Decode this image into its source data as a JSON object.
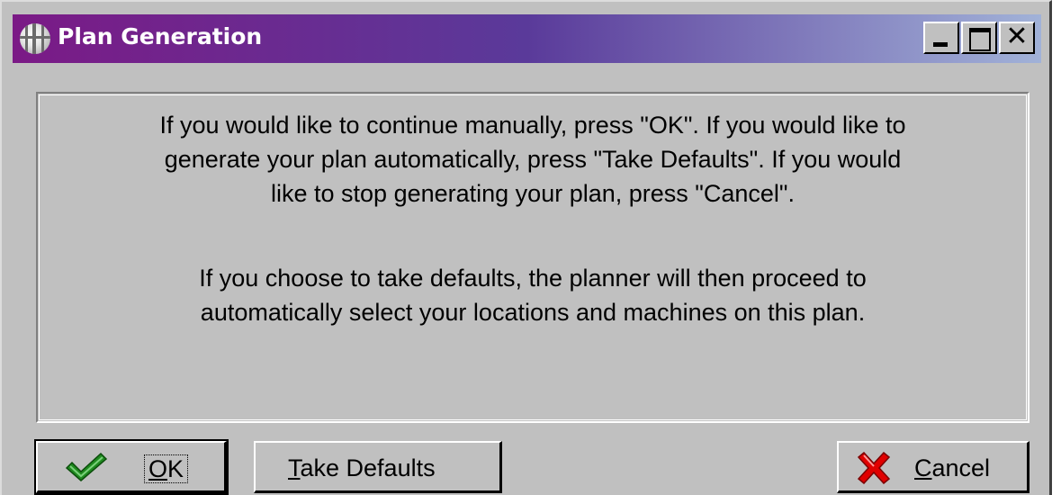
{
  "window": {
    "title": "Plan Generation",
    "title_icon": "globe-icon",
    "controls": {
      "minimize": "minimize-icon",
      "maximize": "maximize-icon",
      "close": "close-icon"
    }
  },
  "message": {
    "paragraph1": "If you would like to continue manually, press \"OK\".  If you would like to\ngenerate your plan automatically, press \"Take Defaults\".  If you would\nlike to stop generating your plan, press \"Cancel\".",
    "paragraph2": "If you choose to take defaults, the planner will then proceed to\nautomatically select your locations and machines on this plan."
  },
  "buttons": {
    "ok": {
      "mnemonic": "O",
      "rest": "K",
      "icon": "checkmark-icon"
    },
    "take_defaults": {
      "mnemonic": "T",
      "rest": "ake Defaults"
    },
    "cancel": {
      "mnemonic": "C",
      "rest": "ancel",
      "icon": "x-mark-icon"
    }
  },
  "colors": {
    "title_gradient_start": "#7b1a86",
    "title_gradient_end": "#a1b2d8",
    "check_green": "#1f8a1f",
    "cancel_red": "#e00000",
    "dialog_face": "#c0c0c0"
  }
}
